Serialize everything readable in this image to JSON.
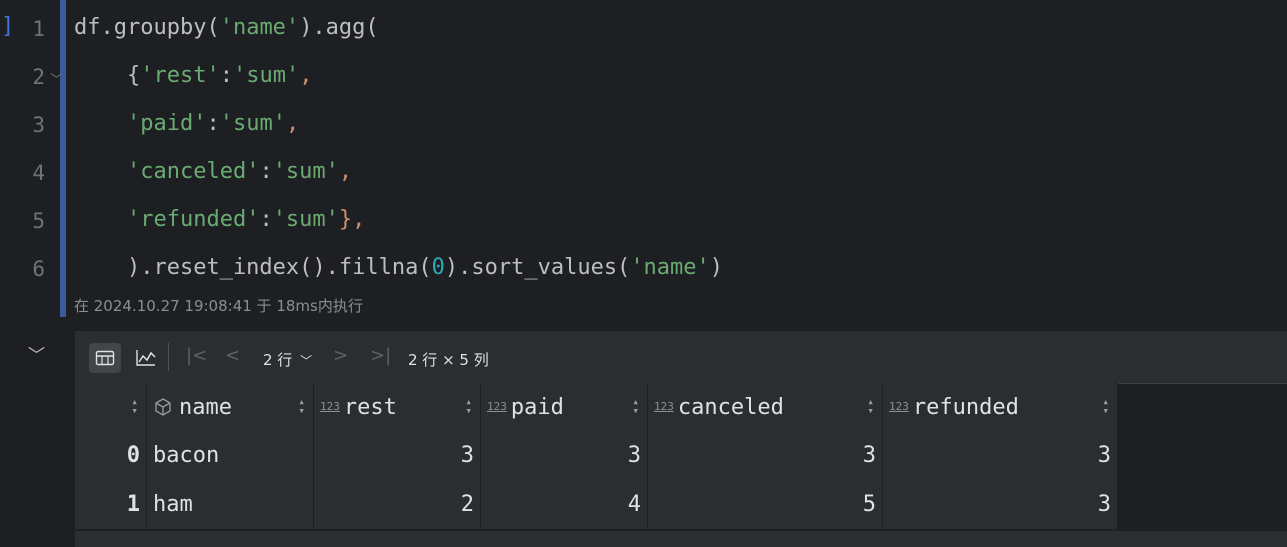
{
  "editor": {
    "line_numbers": [
      "1",
      "2",
      "3",
      "4",
      "5",
      "6"
    ],
    "code_lines": [
      [
        {
          "t": "df.groupby(",
          "c": ""
        },
        {
          "t": "'name'",
          "c": "s"
        },
        {
          "t": ").agg(",
          "c": ""
        }
      ],
      [
        {
          "t": "    {",
          "c": ""
        },
        {
          "t": "'rest'",
          "c": "s"
        },
        {
          "t": ":",
          "c": ""
        },
        {
          "t": "'sum'",
          "c": "s"
        },
        {
          "t": ",",
          "c": "p"
        }
      ],
      [
        {
          "t": "    ",
          "c": ""
        },
        {
          "t": "'paid'",
          "c": "s"
        },
        {
          "t": ":",
          "c": ""
        },
        {
          "t": "'sum'",
          "c": "s"
        },
        {
          "t": ",",
          "c": "p"
        }
      ],
      [
        {
          "t": "    ",
          "c": ""
        },
        {
          "t": "'canceled'",
          "c": "s"
        },
        {
          "t": ":",
          "c": ""
        },
        {
          "t": "'sum'",
          "c": "s"
        },
        {
          "t": ",",
          "c": "p"
        }
      ],
      [
        {
          "t": "    ",
          "c": ""
        },
        {
          "t": "'refunded'",
          "c": "s"
        },
        {
          "t": ":",
          "c": ""
        },
        {
          "t": "'sum'",
          "c": "s"
        },
        {
          "t": "},",
          "c": "p"
        }
      ],
      [
        {
          "t": "    ).reset_index().fillna(",
          "c": ""
        },
        {
          "t": "0",
          "c": "n"
        },
        {
          "t": ").sort_values(",
          "c": ""
        },
        {
          "t": "'name'",
          "c": "s"
        },
        {
          "t": ")",
          "c": ""
        }
      ]
    ],
    "exec_status": "在 2024.10.27 19:08:41 于 18ms内执行"
  },
  "toolbar": {
    "rows_selector": "2 行",
    "dimensions": "2 行 × 5 列"
  },
  "table": {
    "columns": [
      {
        "label": "",
        "type": "index"
      },
      {
        "label": "name",
        "type": "object"
      },
      {
        "label": "rest",
        "type": "123"
      },
      {
        "label": "paid",
        "type": "123"
      },
      {
        "label": "canceled",
        "type": "123"
      },
      {
        "label": "refunded",
        "type": "123"
      }
    ],
    "rows": [
      [
        "0",
        "bacon",
        "3",
        "3",
        "3",
        "3"
      ],
      [
        "1",
        "ham",
        "2",
        "4",
        "5",
        "3"
      ]
    ]
  },
  "colors": {
    "background": "#1e1f22",
    "string": "#6aab73",
    "punctuation": "#cf8e6d",
    "number": "#2aacb8",
    "cell_bar": "#3d5a9c"
  }
}
